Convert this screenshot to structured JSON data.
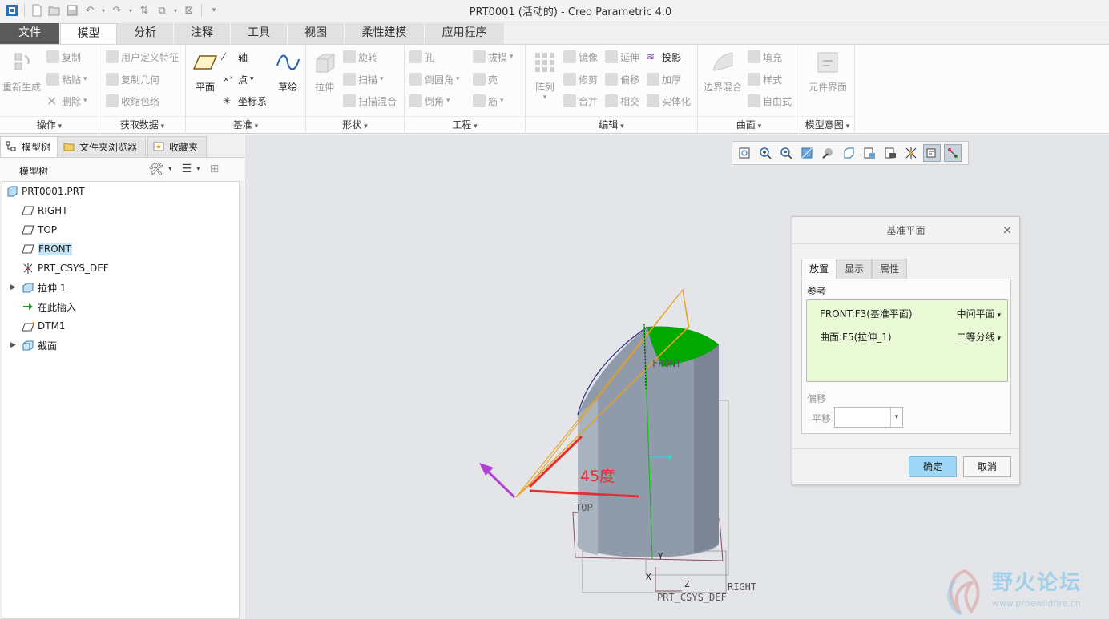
{
  "window": {
    "title": "PRT0001 (活动的) - Creo Parametric 4.0"
  },
  "tabs": [
    "文件",
    "模型",
    "分析",
    "注释",
    "工具",
    "视图",
    "柔性建模",
    "应用程序"
  ],
  "active_tab": "模型",
  "ribbon": {
    "groups": {
      "operations": {
        "label": "操作",
        "regenerate": "重新生成",
        "copy": "复制",
        "paste": "粘贴",
        "delete": "删除"
      },
      "get_data": {
        "label": "获取数据",
        "udf": "用户定义特征",
        "copy_geom": "复制几何",
        "shrinkwrap": "收缩包络"
      },
      "datum": {
        "label": "基准",
        "plane": "平面",
        "axis": "轴",
        "point": "点",
        "csys": "坐标系",
        "sketch": "草绘"
      },
      "shapes": {
        "label": "形状",
        "extrude": "拉伸",
        "revolve": "旋转",
        "sweep": "扫描",
        "swept_blend": "扫描混合"
      },
      "engineering": {
        "label": "工程",
        "hole": "孔",
        "round": "倒圆角",
        "chamfer": "倒角",
        "draft": "拔模",
        "shell": "壳",
        "rib": "筋"
      },
      "editing": {
        "label": "编辑",
        "pattern": "阵列",
        "mirror": "镜像",
        "trim": "修剪",
        "merge": "合并",
        "extend": "延伸",
        "offset": "偏移",
        "intersect": "相交",
        "project": "投影",
        "thicken": "加厚",
        "solidify": "实体化"
      },
      "surfaces": {
        "label": "曲面",
        "boundary_blend": "边界混合",
        "fill": "填充",
        "style": "样式",
        "freestyle": "自由式"
      },
      "model_intent": {
        "label": "模型意图",
        "component_interface": "元件界面"
      }
    }
  },
  "navigator": {
    "tabs": [
      "模型树",
      "文件夹浏览器",
      "收藏夹"
    ],
    "header": "模型树",
    "tree": [
      {
        "label": "PRT0001.PRT",
        "icon": "part-icon",
        "level": 0,
        "expandable": false
      },
      {
        "label": "RIGHT",
        "icon": "datum-plane-icon",
        "level": 1,
        "expandable": false
      },
      {
        "label": "TOP",
        "icon": "datum-plane-icon",
        "level": 1,
        "expandable": false
      },
      {
        "label": "FRONT",
        "icon": "datum-plane-icon",
        "level": 1,
        "expandable": false,
        "selected": true
      },
      {
        "label": "PRT_CSYS_DEF",
        "icon": "csys-icon",
        "level": 1,
        "expandable": false
      },
      {
        "label": "拉伸 1",
        "icon": "extrude-icon",
        "level": 1,
        "expandable": true
      },
      {
        "label": "在此插入",
        "icon": "insert-here-arrow-icon",
        "level": 1,
        "expandable": false
      },
      {
        "label": "DTM1",
        "icon": "new-datum-plane-icon",
        "level": 1,
        "expandable": false
      },
      {
        "label": "截面",
        "icon": "section-icon",
        "level": 1,
        "expandable": true
      }
    ]
  },
  "viewport": {
    "plane_labels": {
      "front": "FRONT",
      "top": "TOP",
      "right": "RIGHT",
      "csys": "PRT_CSYS_DEF"
    },
    "axis_labels": {
      "x": "X",
      "y": "Y",
      "z": "Z"
    },
    "annotation": "45度",
    "colors": {
      "cap": "#00b000",
      "body": "#8f9aab",
      "new_plane": "#e8a020",
      "annotation": "#e53030",
      "arrow": "#b040d0"
    }
  },
  "dialog": {
    "title": "基准平面",
    "tabs": [
      "放置",
      "显示",
      "属性"
    ],
    "active_tab": "放置",
    "references_label": "参考",
    "references": [
      {
        "name": "FRONT:F3(基准平面)",
        "constraint": "中间平面"
      },
      {
        "name": "曲面:F5(拉伸_1)",
        "constraint": "二等分线"
      }
    ],
    "offset_label": "偏移",
    "translation_label": "平移",
    "translation_value": "",
    "ok": "确定",
    "cancel": "取消"
  },
  "watermark": {
    "name": "野火论坛",
    "url": "www.proewildfire.cn"
  }
}
